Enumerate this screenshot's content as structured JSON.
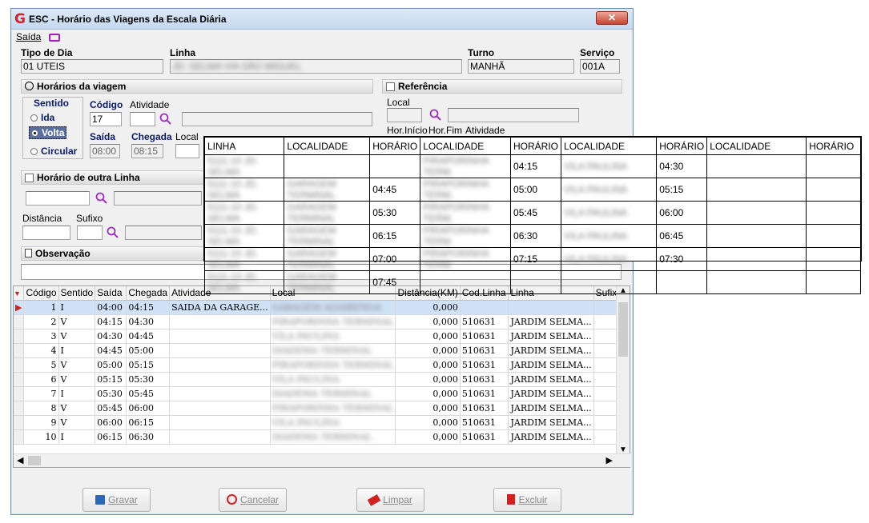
{
  "window": {
    "title": "ESC - Horário das Viagens da Escala Diária",
    "close": "✕"
  },
  "menu": {
    "sair": "Saída"
  },
  "header": {
    "tipo_dia_label": "Tipo de Dia",
    "tipo_dia_value": "01 UTEIS",
    "linha_label": "Linha",
    "linha_value": "JD. SELMA VIA SÃO MIGUEL",
    "turno_label": "Turno",
    "turno_value": "MANHÃ",
    "servico_label": "Serviço",
    "servico_value": "001A"
  },
  "horarios": {
    "title": "Horários da viagem",
    "sentido_label": "Sentido",
    "options": [
      "Ida",
      "Volta",
      "Circular"
    ],
    "selected": "Volta",
    "codigo_label": "Código",
    "codigo_value": "17",
    "atividade_label": "Atividade",
    "saida_label": "Saída",
    "saida_value": "08:00",
    "chegada_label": "Chegada",
    "chegada_value": "08:15",
    "local_label": "Local"
  },
  "referencia": {
    "title": "Referência",
    "local_label": "Local",
    "hor_inicio": "Hor.Início",
    "hor_fim": "Hor.Fim",
    "atividade": "Atividade"
  },
  "outra_linha": {
    "title": "Horário de outra Linha",
    "distancia_label": "Distância",
    "sufixo_label": "Sufixo"
  },
  "observacao": {
    "title": "Observação"
  },
  "overlay": {
    "headers": [
      "LINHA",
      "LOCALIDADE",
      "HORÁRIO",
      "LOCALIDADE",
      "HORÁRIO",
      "LOCALIDADE",
      "HORÁRIO",
      "LOCALIDADE",
      "HORÁRIO"
    ],
    "rows": [
      [
        "5111-10 JD. SELMA",
        "",
        "",
        "PIRAPORINHA TERM.",
        "04:15",
        "VILA PAULINA",
        "04:30",
        "",
        ""
      ],
      [
        "5111-10 JD. SELMA",
        "GARAGEM TERMINAL",
        "04:45",
        "PIRAPORINHA TERM.",
        "05:00",
        "VILA PAULINA",
        "05:15",
        "",
        ""
      ],
      [
        "5111-10 JD. SELMA",
        "GARAGEM TERMINAL",
        "05:30",
        "PIRAPORINHA TERM.",
        "05:45",
        "VILA PAULINA",
        "06:00",
        "",
        ""
      ],
      [
        "5111-10 JD. SELMA",
        "GARAGEM TERMINAL",
        "06:15",
        "PIRAPORINHA TERM.",
        "06:30",
        "VILA PAULINA",
        "06:45",
        "",
        ""
      ],
      [
        "5111-10 JD. SELMA",
        "GARAGEM TERMINAL",
        "07:00",
        "PIRAPORINHA TERM.",
        "07:15",
        "VILA PAULINA",
        "07:30",
        "",
        ""
      ],
      [
        "5111-10 JD. SELMA",
        "GARAGEM TERMINAL",
        "07:45",
        "",
        "",
        "",
        "",
        "",
        ""
      ]
    ]
  },
  "grid": {
    "columns": [
      "Código",
      "Sentido",
      "Saída",
      "Chegada",
      "Atividade",
      "Local",
      "Distância(KM)",
      "Cod.Linha",
      "Linha",
      "Sufixo"
    ],
    "rows": [
      [
        "1",
        "I",
        "04:00",
        "04:15",
        "SAIDA DA GARAGE...",
        "GARAGEM ALVARENGA",
        "0,000",
        "",
        "",
        ""
      ],
      [
        "2",
        "V",
        "04:15",
        "04:30",
        "",
        "PIRAPORINHA TERMINAL",
        "0,000",
        "510631",
        "JARDIM SELMA...",
        ""
      ],
      [
        "3",
        "V",
        "04:30",
        "04:45",
        "",
        "VILA PAULINA",
        "0,000",
        "510631",
        "JARDIM SELMA...",
        ""
      ],
      [
        "4",
        "I",
        "04:45",
        "05:00",
        "",
        "DIADEMA TERMINAL",
        "0,000",
        "510631",
        "JARDIM SELMA...",
        ""
      ],
      [
        "5",
        "V",
        "05:00",
        "05:15",
        "",
        "PIRAPORINHA TERMINAL",
        "0,000",
        "510631",
        "JARDIM SELMA...",
        ""
      ],
      [
        "6",
        "V",
        "05:15",
        "05:30",
        "",
        "VILA PAULINA",
        "0,000",
        "510631",
        "JARDIM SELMA...",
        ""
      ],
      [
        "7",
        "I",
        "05:30",
        "05:45",
        "",
        "DIADEMA TERMINAL",
        "0,000",
        "510631",
        "JARDIM SELMA...",
        ""
      ],
      [
        "8",
        "V",
        "05:45",
        "06:00",
        "",
        "PIRAPORINHA TERMINAL",
        "0,000",
        "510631",
        "JARDIM SELMA...",
        ""
      ],
      [
        "9",
        "V",
        "06:00",
        "06:15",
        "",
        "VILA PAULINA",
        "0,000",
        "510631",
        "JARDIM SELMA...",
        ""
      ],
      [
        "10",
        "I",
        "06:15",
        "06:30",
        "",
        "DIADEMA TERMINAL",
        "0,000",
        "510631",
        "JARDIM SELMA...",
        ""
      ]
    ]
  },
  "buttons": {
    "gravar": "Gravar",
    "cancelar": "Cancelar",
    "limpar": "Limpar",
    "excluir": "Excluir"
  },
  "colors": {
    "accent": "#d4202c",
    "selection": "#cfe2f7",
    "window_border": "#6f8fb5"
  }
}
